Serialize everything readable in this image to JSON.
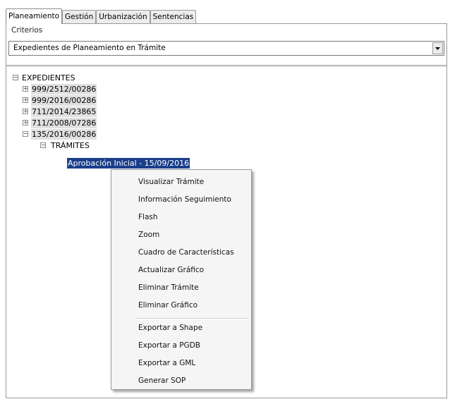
{
  "tabs": [
    {
      "label": "Planeamiento",
      "active": true
    },
    {
      "label": "Gestión",
      "active": false
    },
    {
      "label": "Urbanización",
      "active": false
    },
    {
      "label": "Sentencias",
      "active": false
    }
  ],
  "criteria": {
    "label": "Criterios",
    "selected": "Expedientes de Planeamiento en Trámite"
  },
  "tree": {
    "root": "EXPEDIENTES",
    "items": [
      "999/2512/00286",
      "999/2016/00286",
      "711/2014/23865",
      "711/2008/07286",
      "135/2016/00286"
    ],
    "tramites_label": "TRÁMITES",
    "selected_node": "Aprobación Inicial - 15/09/2016"
  },
  "context_menu": {
    "items": [
      "Visualizar Trámite",
      "Información Seguimiento",
      "Flash",
      "Zoom",
      "Cuadro de Características",
      "Actualizar Gráfico",
      "Eliminar Trámite",
      "Eliminar Gráfico"
    ],
    "export_items": [
      "Exportar a Shape",
      "Exportar a PGDB",
      "Exportar a GML",
      "Generar SOP"
    ]
  }
}
